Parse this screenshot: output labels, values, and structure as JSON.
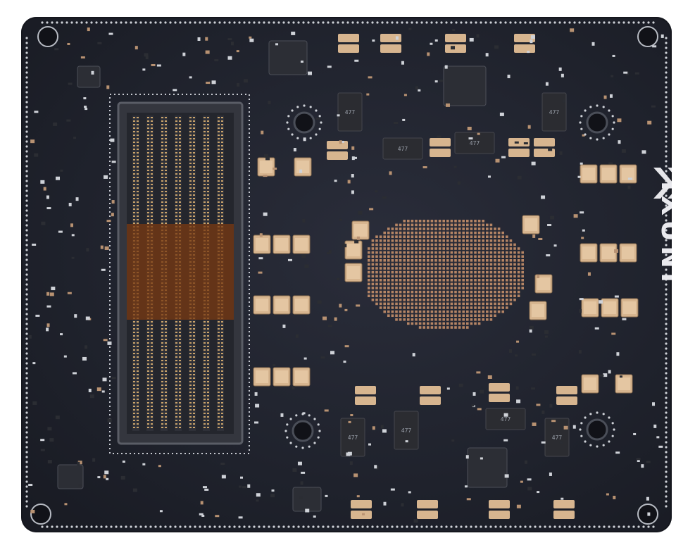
{
  "board": {
    "brand": "IXUNI",
    "colors": {
      "pcb": "#1f222c",
      "pad": "#d9b28a",
      "capacitor": "#d7b58f",
      "tantalum": "#2b2c31",
      "connector": "#3a3b42",
      "gold": "#c8a26a",
      "silkscreen": "#e6e6ea"
    },
    "tantalum_label": "477"
  }
}
